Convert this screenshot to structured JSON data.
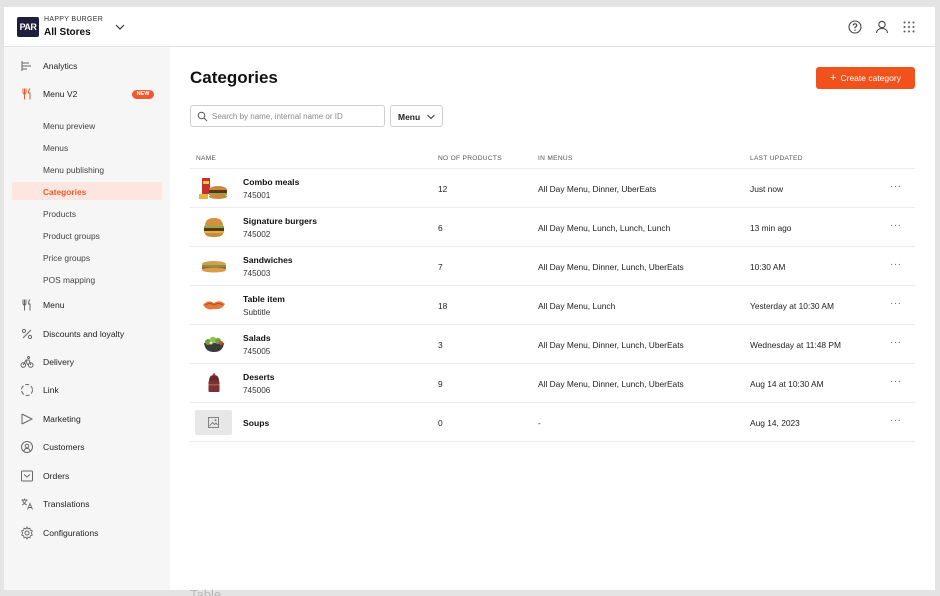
{
  "topbar": {
    "logo_text": "PAR",
    "brand_small": "HAPPY BURGER",
    "store": "All Stores",
    "icons": [
      "help-circle-icon",
      "user-icon",
      "apps-grid-icon"
    ]
  },
  "sidebar": {
    "analytics": "Analytics",
    "menu_v2": "Menu V2",
    "menu_v2_badge": "NEW",
    "sub_items": [
      "Menu preview",
      "Menus",
      "Menu publishing",
      "Categories",
      "Products",
      "Product groups",
      "Price groups",
      "POS mapping"
    ],
    "active_sub": "Categories",
    "menu": "Menu",
    "discounts": "Discounts and loyalty",
    "delivery": "Delivery",
    "link": "Link",
    "marketing": "Marketing",
    "customers": "Customers",
    "orders": "Orders",
    "translations": "Translations",
    "configurations": "Configurations"
  },
  "main": {
    "title": "Categories",
    "create_button": "Create category",
    "search_placeholder": "Search by name, internal name or ID",
    "filter_label": "Menu",
    "columns": {
      "name": "NAME",
      "count": "NO OF PRODUCTS",
      "menus": "IN MENUS",
      "updated": "LAST UPDATED"
    },
    "rows": [
      {
        "name": "Combo meals",
        "sub": "745001",
        "count": "12",
        "menus": "All Day Menu, Dinner, UberEats",
        "updated": "Just now",
        "thumb": "combo-meal-image"
      },
      {
        "name": "Signature burgers",
        "sub": "745002",
        "count": "6",
        "menus": "All Day Menu, Lunch, Lunch, Lunch",
        "updated": "13 min ago",
        "thumb": "burger-image"
      },
      {
        "name": "Sandwiches",
        "sub": "745003",
        "count": "7",
        "menus": "All Day Menu, Dinner, Lunch, UberEats",
        "updated": "10:30 AM",
        "thumb": "sandwich-image"
      },
      {
        "name": "Table item",
        "sub": "Subtitle",
        "count": "18",
        "menus": "All Day Menu, Lunch",
        "updated": "Yesterday at 10:30 AM",
        "thumb": "table-item-image"
      },
      {
        "name": "Salads",
        "sub": "745005",
        "count": "3",
        "menus": "All Day Menu, Dinner, Lunch, UberEats",
        "updated": "Wednesday at 11:48 PM",
        "thumb": "salad-image"
      },
      {
        "name": "Deserts",
        "sub": "745006",
        "count": "9",
        "menus": "All Day Menu, Dinner, Lunch, UberEats",
        "updated": "Aug 14 at 10:30 AM",
        "thumb": "dessert-image"
      },
      {
        "name": "Soups",
        "sub": "",
        "count": "0",
        "menus": "-",
        "updated": "Aug 14, 2023",
        "thumb": "image-placeholder-icon"
      }
    ],
    "more_label": "···"
  },
  "footer_label": "Table",
  "colors": {
    "accent": "#f1511b",
    "active_bg": "#fde6e0",
    "sidebar_bg": "#f6f6f6",
    "logo_bg": "#1f1f3d"
  }
}
